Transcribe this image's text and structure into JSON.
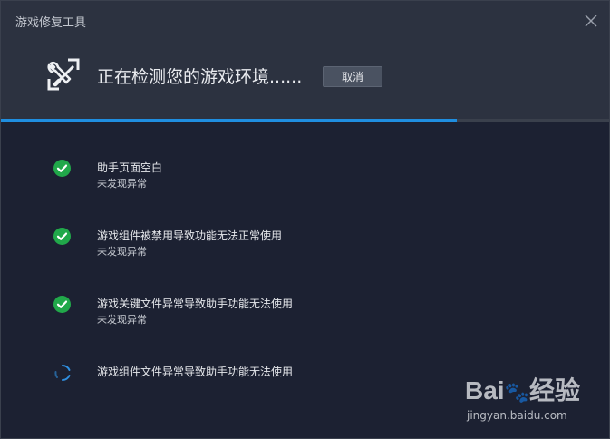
{
  "window": {
    "title": "游戏修复工具",
    "close_icon": "close-icon"
  },
  "header": {
    "heading": "正在检测您的游戏环境......",
    "cancel_label": "取消",
    "icon": "wrench-icon"
  },
  "progress": {
    "percent": 75
  },
  "checks": [
    {
      "title": "助手页面空白",
      "status": "未发现异常",
      "state": "done"
    },
    {
      "title": "游戏组件被禁用导致功能无法正常使用",
      "status": "未发现异常",
      "state": "done"
    },
    {
      "title": "游戏关键文件异常导致助手功能无法使用",
      "status": "未发现异常",
      "state": "done"
    },
    {
      "title": "游戏组件文件异常导致助手功能无法使用",
      "status": "",
      "state": "loading"
    }
  ],
  "watermark": {
    "brand": "Bai",
    "brand_suffix": "经验",
    "url": "jingyan.baidu.com"
  },
  "colors": {
    "accent": "#1f8ee0",
    "success": "#21a84a",
    "header_bg": "#2c3240",
    "body_bg": "#1c2132"
  }
}
